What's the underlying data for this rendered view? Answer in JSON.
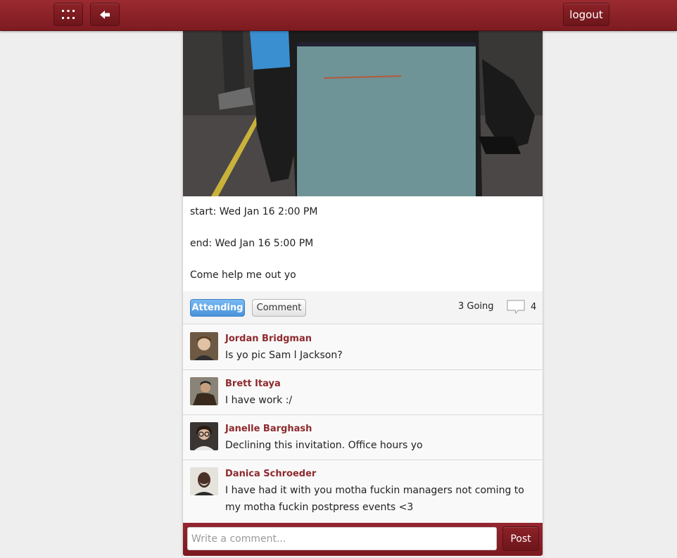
{
  "topbar": {
    "menu_icon": "grid-icon",
    "back_icon": "arrow-left-icon",
    "logout_label": "logout"
  },
  "event": {
    "start": "start: Wed Jan 16 2:00 PM",
    "end": "end: Wed Jan 16 5:00 PM",
    "description": "Come help me out yo"
  },
  "actions": {
    "attending_label": "Attending",
    "comment_label": "Comment",
    "going_text": "3 Going",
    "comment_count": "4",
    "comment_icon": "speech-bubble-icon"
  },
  "comments": [
    {
      "name": "Jordan Bridgman",
      "text": "Is yo pic Sam l Jackson?"
    },
    {
      "name": "Brett Itaya",
      "text": "I have work :/"
    },
    {
      "name": "Janelle Barghash",
      "text": "Declining this invitation. Office hours yo"
    },
    {
      "name": "Danica Schroeder",
      "text": "I have had it with you motha fuckin managers not coming to my motha fuckin postpress events <3"
    }
  ],
  "composer": {
    "placeholder": "Write a comment...",
    "value": "",
    "post_label": "Post"
  },
  "colors": {
    "brand": "#8b1f25",
    "accent_blue": "#4a93dc",
    "name_color": "#8e2a2e"
  }
}
